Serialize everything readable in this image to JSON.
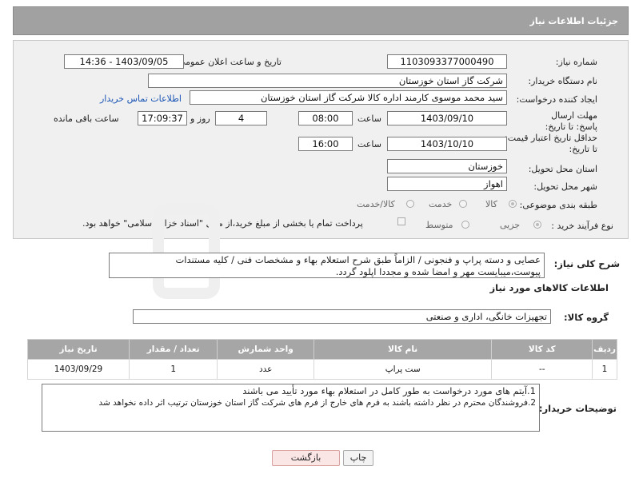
{
  "header": {
    "title": "جزئیات اطلاعات نیاز"
  },
  "fields": {
    "need_number_label": "شماره نیاز:",
    "need_number": "1103093377000490",
    "announce_label": "تاریخ و ساعت اعلان عمومی:",
    "announce_value": "1403/09/05 - 14:36",
    "buyer_org_label": "نام دستگاه خریدار:",
    "buyer_org": "شرکت گاز استان خوزستان",
    "creator_label": "ایجاد کننده درخواست:",
    "creator": "سید محمد موسوی کارمند اداره کالا شرکت گاز استان خوزستان",
    "buyer_contact_link": "اطلاعات تماس خریدار",
    "reply_deadline_label": "مهلت ارسال پاسخ: تا تاریخ:",
    "reply_date": "1403/09/10",
    "time_label": "ساعت",
    "reply_time": "08:00",
    "days": "4",
    "days_label": "روز و",
    "remaining": "17:09:37",
    "remaining_label": "ساعت باقی مانده",
    "validity_label": "حداقل تاریخ اعتبار قیمت: تا تاریخ:",
    "validity_date": "1403/10/10",
    "validity_time": "16:00",
    "province_label": "استان محل تحویل:",
    "province": "خوزستان",
    "city_label": "شهر محل تحویل:",
    "city": "اهواز",
    "category_label": "طبقه بندی موضوعی:",
    "category_options": [
      "کالا",
      "خدمت",
      "کالا/خدمت"
    ],
    "process_label": "نوع فرآیند خرید :",
    "process_options": [
      "جزیی",
      "متوسط"
    ],
    "payment_note": "پرداخت تمام یا بخشی از مبلغ خرید،از محل \"اسناد خزانه اسلامی\" خواهد بود."
  },
  "general_description": {
    "label": "شرح کلی نیاز:",
    "line1": "عصایی و دسته پراپ و فنجونی / الزاماً طبق شرح استعلام بهاء و مشخصات فنی / کلیه مستندات",
    "line2": "پیوست،میبایست مهر و امضا شده و مجددا اپلود گردد."
  },
  "goods_info": {
    "title": "اطلاعات کالاهای مورد نیاز",
    "group_label": "گروه کالا:",
    "group_value": "تجهیزات خانگی، اداری و صنعتی"
  },
  "table": {
    "headers": [
      "ردیف",
      "کد کالا",
      "نام کالا",
      "واحد شمارش",
      "تعداد / مقدار",
      "تاریخ نیاز"
    ],
    "rows": [
      [
        "1",
        "--",
        "ست پراپ",
        "عدد",
        "1",
        "1403/09/29"
      ]
    ]
  },
  "buyer_notes": {
    "label": "توضیحات خریدار:",
    "line1": "1.آیتم های مورد درخواست به طور کامل در استعلام بهاء مورد تأیید می باشند",
    "line2": "2.فروشندگان محترم در نظر داشته باشند به فرم های خارج از فرم های شرکت گاز استان خوزستان ترتیب اثر داده نخواهد شد"
  },
  "buttons": {
    "print": "چاپ",
    "back": "بازگشت"
  }
}
